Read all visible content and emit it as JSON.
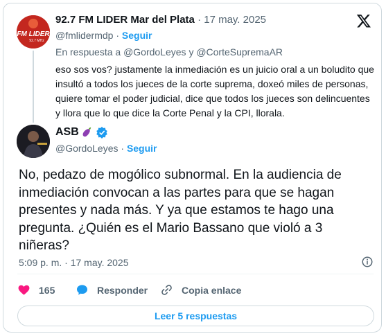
{
  "quoted": {
    "author_name": "92.7 FM LIDER Mar del Plata",
    "date": "· 17 may. 2025",
    "handle": "@fmlidermdp",
    "follow_label": "Seguir",
    "reply_prefix": "En respuesta a",
    "reply_to_1": "@GordoLeyes",
    "reply_and": "y",
    "reply_to_2": "@CorteSupremaAR",
    "text": "eso sos vos? justamente la inmediación es un juicio oral a un boludito que insultó a todos los jueces de la corte suprema, doxeó miles de personas, quiere tomar el poder judicial, dice que todos los jueces son delincuentes y llora que lo que dice la Corte Penal y la CPI, llorala.",
    "avatar_logo_text": "FM LIDER",
    "avatar_logo_sub": "92.7 MHz"
  },
  "main": {
    "author_name": "ASB",
    "handle": "@GordoLeyes",
    "follow_label": "Seguir",
    "text": "No, pedazo de mogólico subnormal. En la audiencia de inmediación convocan a las partes para que se hagan presentes y nada más. Y ya que estamos te hago una pregunta. ¿Quién es el Mario Bassano que violó a 3 niñeras?",
    "timestamp": "5:09 p. m. · 17 may. 2025"
  },
  "actions": {
    "likes": "165",
    "reply_label": "Responder",
    "copy_label": "Copia enlace"
  },
  "more_replies_label": "Leer 5 respuestas",
  "colors": {
    "accent": "#1d9bf0",
    "like": "#f91880",
    "verified": "#1d9bf0"
  },
  "icons": [
    "x-logo-icon",
    "eggplant-emoji-icon",
    "verified-badge-icon",
    "info-icon",
    "heart-icon",
    "reply-bubble-icon",
    "link-icon"
  ]
}
